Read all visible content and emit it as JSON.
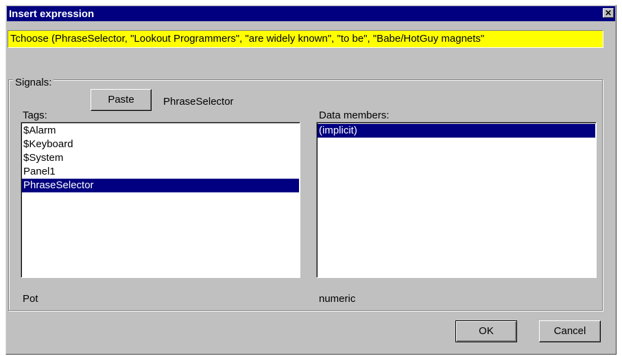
{
  "window": {
    "title": "Insert expression",
    "close_glyph": "✕"
  },
  "expression": {
    "value": "Tchoose (PhraseSelector, \"Lookout Programmers\", \"are widely known\", \"to be\", \"Babe/HotGuy magnets\""
  },
  "signals": {
    "group_label": "Signals:",
    "paste_label": "Paste",
    "paste_target": "PhraseSelector",
    "tags_label": "Tags:",
    "data_members_label": "Data members:",
    "tags": [
      {
        "label": "$Alarm",
        "selected": false
      },
      {
        "label": "$Keyboard",
        "selected": false
      },
      {
        "label": "$System",
        "selected": false
      },
      {
        "label": "Panel1",
        "selected": false
      },
      {
        "label": "PhraseSelector",
        "selected": true
      }
    ],
    "data_members": [
      {
        "label": "(implicit)",
        "selected": true
      }
    ],
    "tag_type": "Pot",
    "member_type": "numeric"
  },
  "buttons": {
    "ok_label": "OK",
    "cancel_label": "Cancel"
  },
  "colors": {
    "title_bar": "#000080",
    "selection": "#000080",
    "expression_bg": "#ffff00",
    "dialog_bg": "#c0c0c0"
  },
  "icons": {
    "close": "close-icon"
  }
}
